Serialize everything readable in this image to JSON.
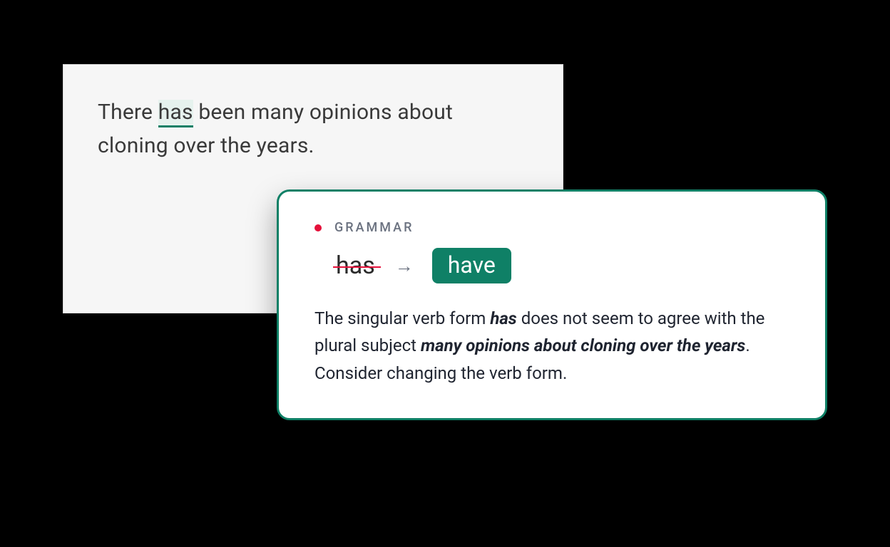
{
  "editor": {
    "pre": "There ",
    "flagged": "has",
    "post": " been many opinions about cloning over the years."
  },
  "popover": {
    "category": "GRAMMAR",
    "original": "has",
    "arrow": "→",
    "suggestion": "have",
    "explanation": {
      "p1": "The singular verb form ",
      "b1": "has",
      "p2": " does not seem to agree with the plural subject ",
      "b2": "many opinions about cloning over the years",
      "p3": ". Consider changing the verb form."
    }
  },
  "colors": {
    "accent": "#0f8066",
    "error": "#e5103a"
  }
}
